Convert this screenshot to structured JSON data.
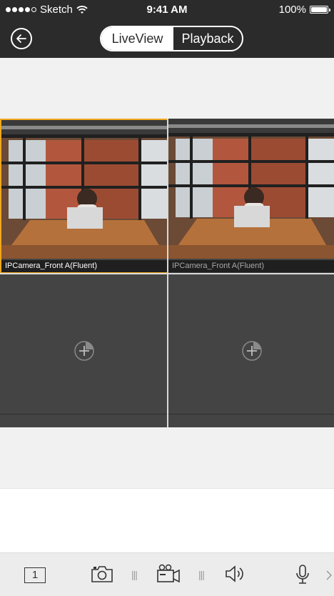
{
  "status_bar": {
    "carrier": "Sketch",
    "time": "9:41 AM",
    "battery": "100%",
    "battery_level": 1.0
  },
  "nav": {
    "back_icon": "arrow-left-circle-icon",
    "tabs": [
      {
        "label": "LiveView",
        "active": true
      },
      {
        "label": "Playback",
        "active": false
      }
    ]
  },
  "grid": {
    "cells": [
      {
        "camera": "IPCamera_Front A(Fluent)",
        "selected": true,
        "label_color": "#ffffff"
      },
      {
        "camera": "IPCamera_Front A(Fluent)",
        "selected": false,
        "label_color": "#a8a8a8"
      },
      {
        "empty": true,
        "icon": "add-camera-icon"
      },
      {
        "empty": true,
        "icon": "add-camera-icon"
      }
    ]
  },
  "toolbar": {
    "items": [
      {
        "icon": "single-layout-icon",
        "text": "1"
      },
      {
        "icon": "camera-snapshot-icon"
      },
      {
        "icon": "video-record-icon"
      },
      {
        "icon": "speaker-icon"
      },
      {
        "icon": "microphone-icon"
      },
      {
        "icon": "chevron-right-icon"
      }
    ]
  },
  "colors": {
    "bar": "#2b2b2b",
    "accent": "#f0a81e",
    "grid_bg": "#444444",
    "toolbar_icon": "#333333"
  }
}
